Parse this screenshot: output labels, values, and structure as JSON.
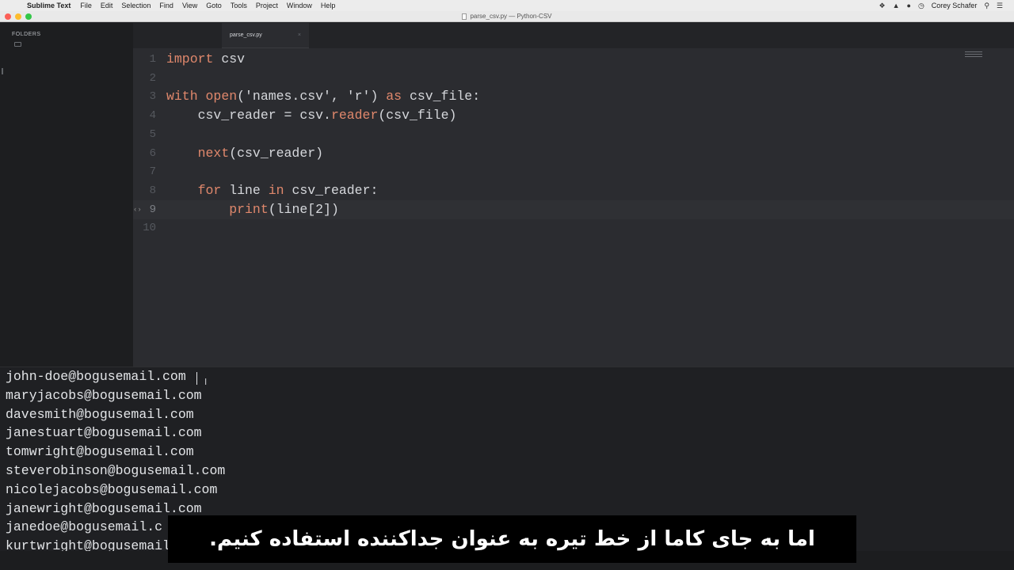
{
  "menubar": {
    "app_name": "Sublime Text",
    "items": [
      "File",
      "Edit",
      "Selection",
      "Find",
      "View",
      "Goto",
      "Tools",
      "Project",
      "Window",
      "Help"
    ],
    "user": "Corey Schafer",
    "icons": [
      "dropbox-icon",
      "drive-icon",
      "notification-icon",
      "history-icon",
      "search-icon",
      "menu-list-icon"
    ]
  },
  "window": {
    "title": "parse_csv.py — Python-CSV",
    "traffic_light_colors": [
      "#fc5f57",
      "#fdbc2e",
      "#33c748"
    ]
  },
  "sidebar": {
    "title": "FOLDERS"
  },
  "tabs": [
    {
      "active": false
    },
    {
      "label": "parse_csv.py",
      "active": true,
      "close": "×"
    }
  ],
  "editor": {
    "lines": [
      {
        "n": "1",
        "tokens": [
          [
            "kw",
            "import"
          ],
          [
            "plain",
            " csv"
          ]
        ]
      },
      {
        "n": "2",
        "tokens": []
      },
      {
        "n": "3",
        "tokens": [
          [
            "kw",
            "with"
          ],
          [
            "plain",
            " "
          ],
          [
            "fn",
            "open"
          ],
          [
            "plain",
            "('names.csv', 'r') "
          ],
          [
            "kw",
            "as"
          ],
          [
            "plain",
            " csv_file:"
          ]
        ]
      },
      {
        "n": "4",
        "tokens": [
          [
            "plain",
            "    csv_reader = csv."
          ],
          [
            "fn",
            "reader"
          ],
          [
            "plain",
            "(csv_file)"
          ]
        ]
      },
      {
        "n": "5",
        "tokens": []
      },
      {
        "n": "6",
        "tokens": [
          [
            "plain",
            "    "
          ],
          [
            "fn",
            "next"
          ],
          [
            "plain",
            "(csv_reader)"
          ]
        ]
      },
      {
        "n": "7",
        "tokens": []
      },
      {
        "n": "8",
        "tokens": [
          [
            "plain",
            "    "
          ],
          [
            "kw",
            "for"
          ],
          [
            "plain",
            " line "
          ],
          [
            "kw",
            "in"
          ],
          [
            "plain",
            " csv_reader:"
          ]
        ]
      },
      {
        "n": "9",
        "tokens": [
          [
            "plain",
            "        "
          ],
          [
            "fn",
            "print"
          ],
          [
            "plain",
            "(line[2])"
          ]
        ],
        "current": true
      },
      {
        "n": "10",
        "tokens": []
      }
    ],
    "fold_marker": "‹›"
  },
  "output": {
    "lines": [
      "john-doe@bogusemail.com",
      "maryjacobs@bogusemail.com",
      "davesmith@bogusemail.com",
      "janestuart@bogusemail.com",
      "tomwright@bogusemail.com",
      "steverobinson@bogusemail.com",
      "nicolejacobs@bogusemail.com",
      "janewright@bogusemail.com",
      "janedoe@bogusemail.c",
      "kurtwright@bogusemail.com"
    ],
    "ibeam": "I"
  },
  "subtitle": {
    "text": "اما به جای کاما از خط تیره به عنوان جداکننده استفاده کنیم."
  },
  "colors": {
    "keyword": "#e0886c",
    "text": "#d6d8dc",
    "editor_bg": "#2b2c30",
    "output_bg": "#1f2023"
  }
}
